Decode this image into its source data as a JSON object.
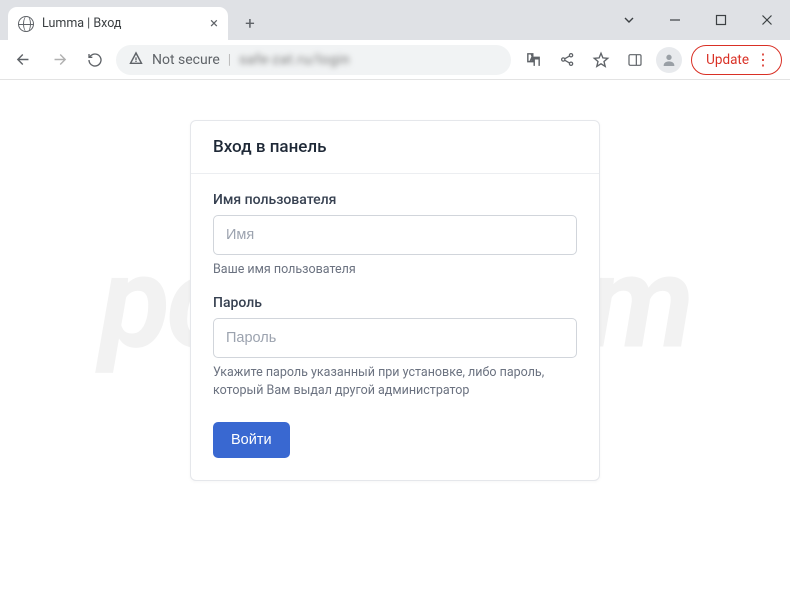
{
  "browser": {
    "tab_title": "Lumma | Вход",
    "address_prefix": "Not secure",
    "address_blurred": "safe-zat.ru/login",
    "update_label": "Update"
  },
  "card": {
    "title": "Вход в панель",
    "username": {
      "label": "Имя пользователя",
      "placeholder": "Имя",
      "help": "Ваше имя пользователя"
    },
    "password": {
      "label": "Пароль",
      "placeholder": "Пароль",
      "help": "Укажите пароль указанный при установке, либо пароль, который Вам выдал другой администратор"
    },
    "submit_label": "Войти"
  },
  "watermark": "pcrisk.com"
}
